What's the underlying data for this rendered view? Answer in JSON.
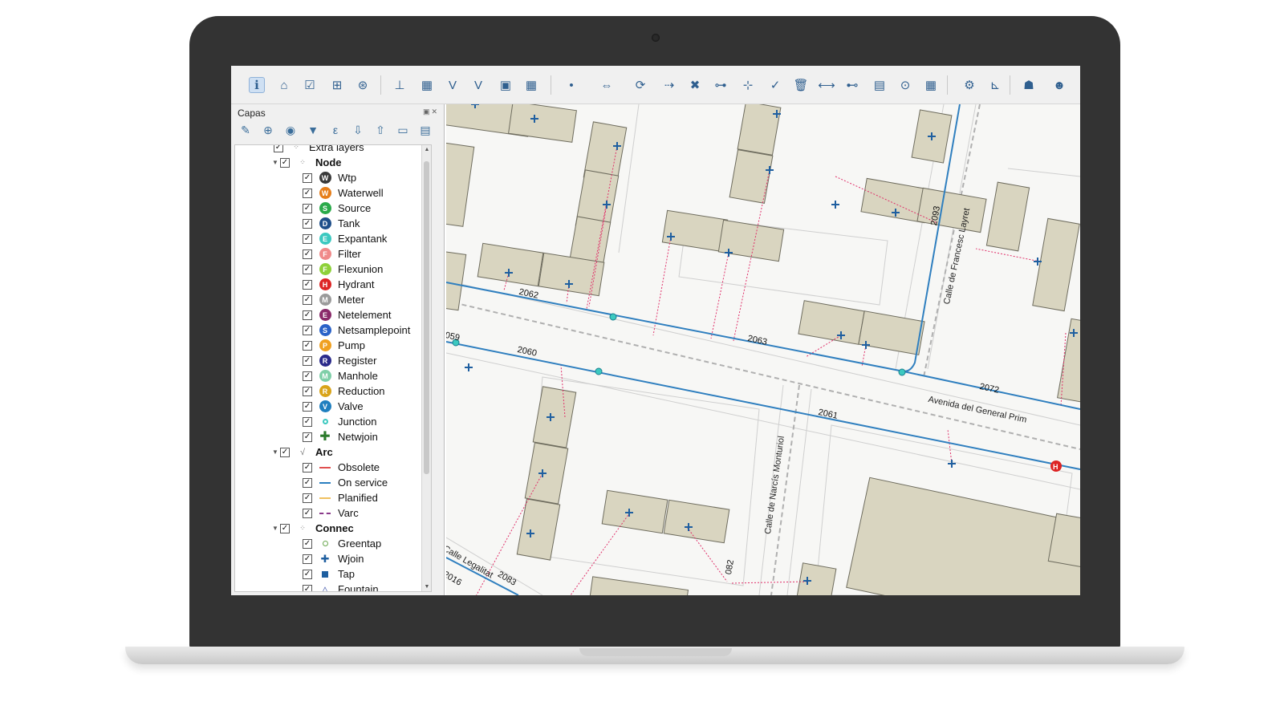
{
  "panel": {
    "title": "Capas",
    "clipped_item": "Extra layers"
  },
  "toolbar": {
    "icons": [
      "identify-icon",
      "home-icon",
      "check-icon",
      "selection-icon",
      "zoom-icon",
      "node-add-icon",
      "table-icon",
      "validate-icon",
      "visit-icon",
      "table-edit-icon",
      "calendar-icon",
      "node-insert-icon",
      "node-move-icon",
      "refresh-icon",
      "connect-icon",
      "delete-node-icon",
      "arc-add-icon",
      "arc-split-icon",
      "check-node-icon",
      "delete-icon",
      "measure-icon",
      "link-icon",
      "document-icon",
      "node-info-icon",
      "report-icon",
      "gear-icon",
      "profile-icon",
      "user-icon",
      "account-icon"
    ]
  },
  "tree": {
    "node_group": "Node",
    "node_items": [
      {
        "label": "Wtp",
        "letter": "W",
        "color": "#3a3a3a"
      },
      {
        "label": "Waterwell",
        "letter": "W",
        "color": "#e67e1a"
      },
      {
        "label": "Source",
        "letter": "S",
        "color": "#2aaa4a"
      },
      {
        "label": "Tank",
        "letter": "D",
        "color": "#1f4f8a"
      },
      {
        "label": "Expantank",
        "letter": "E",
        "color": "#3cc9c0"
      },
      {
        "label": "Filter",
        "letter": "F",
        "color": "#f08a8a"
      },
      {
        "label": "Flexunion",
        "letter": "F",
        "color": "#8ed13a"
      },
      {
        "label": "Hydrant",
        "letter": "H",
        "color": "#dd2424"
      },
      {
        "label": "Meter",
        "letter": "M",
        "color": "#9a9a9a"
      },
      {
        "label": "Netelement",
        "letter": "E",
        "color": "#8a2a6a"
      },
      {
        "label": "Netsamplepoint",
        "letter": "S",
        "color": "#2a62c8"
      },
      {
        "label": "Pump",
        "letter": "P",
        "color": "#f0a020"
      },
      {
        "label": "Register",
        "letter": "R",
        "color": "#2a2a8a"
      },
      {
        "label": "Manhole",
        "letter": "M",
        "color": "#7fcfa8"
      },
      {
        "label": "Reduction",
        "letter": "R",
        "color": "#d9a41a"
      },
      {
        "label": "Valve",
        "letter": "V",
        "color": "#1f7fbf"
      },
      {
        "label": "Junction",
        "letter": "",
        "color": "#3cc9c0"
      },
      {
        "label": "Netwjoin",
        "letter": "",
        "color": "#2a7a2a"
      }
    ],
    "arc_group": "Arc",
    "arc_items": [
      {
        "label": "Obsolete",
        "color": "#e05050",
        "dash": false
      },
      {
        "label": "On service",
        "color": "#2a7fc0",
        "dash": false
      },
      {
        "label": "Planified",
        "color": "#f0c060",
        "dash": false
      },
      {
        "label": "Varc",
        "color": "#8a3a8a",
        "dash": true
      }
    ],
    "connec_group": "Connec",
    "connec_items": [
      {
        "label": "Greentap",
        "symbol": "circle",
        "color": "#6aa84f"
      },
      {
        "label": "Wjoin",
        "symbol": "cross",
        "color": "#1f5fa0"
      },
      {
        "label": "Tap",
        "symbol": "square",
        "color": "#1f5fa0"
      },
      {
        "label": "Fountain",
        "symbol": "triangle",
        "color": "#3a4fa8"
      }
    ]
  },
  "map": {
    "streets": {
      "general_prim": "Avenida del General Prim",
      "francesc_layret": "Calle de Francesc Layret",
      "narcis_monturiol": "Calle de Narcís Monturiol",
      "legalitat": "Calle Legalitat"
    },
    "arc_labels": [
      "2062",
      "2063",
      "059",
      "2060",
      "2072",
      "2061",
      "2093",
      "2016",
      "2083",
      "082"
    ],
    "colors": {
      "building": "#d9d5c0",
      "building_stroke": "#6e6c5e",
      "pipe": "#2f7fbf",
      "connec": "#e0306a",
      "node": "#3cc9c0",
      "hydrant": "#dd2424"
    }
  }
}
